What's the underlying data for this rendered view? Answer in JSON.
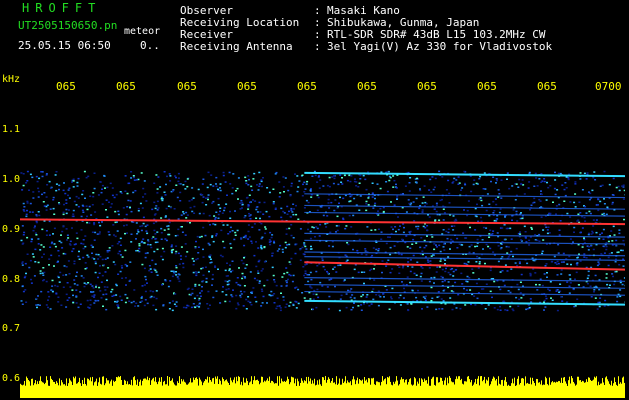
{
  "header": {
    "app_title": "HROFFT",
    "file_name": "UT2505150650.pn",
    "file_tag": "meteor",
    "date_time": "25.05.15 06:50",
    "count": "0.."
  },
  "metadata": [
    {
      "label": "Observer",
      "value": "Masaki Kano"
    },
    {
      "label": "Receiving Location",
      "value": "Shibukawa, Gunma, Japan"
    },
    {
      "label": "Receiver",
      "value": "RTL-SDR SDR# 43dB L15 103.2MHz CW"
    },
    {
      "label": "Receiving Antenna",
      "value": "3el Yagi(V) Az 330 for Vladivostok"
    }
  ],
  "colors": {
    "background": "#000000",
    "text_green": "#22dd22",
    "axis_yellow": "#ffff00",
    "echo_red": "#ff3333",
    "echo_cyan": "#33ddff",
    "noise_blue": "#1133cc"
  },
  "chart_data": {
    "type": "heatmap",
    "unit_label": "kHz",
    "y_tick_labels": [
      "1.1",
      "1.0",
      "0.9",
      "0.8",
      "0.7",
      "0.6"
    ],
    "x_tick_labels": [
      "065",
      "065",
      "065",
      "065",
      "065",
      "065",
      "065",
      "065",
      "065",
      "0700"
    ],
    "ylim": [
      0.6,
      1.15
    ],
    "strong_lines": [
      {
        "start_frac": 0.0,
        "end_frac": 1.0,
        "y_start": 0.945,
        "y_end": 0.935,
        "color": "red"
      },
      {
        "start_frac": 0.47,
        "end_frac": 1.0,
        "y_start": 0.853,
        "y_end": 0.837,
        "color": "red"
      },
      {
        "start_frac": 0.47,
        "end_frac": 1.0,
        "y_start": 1.045,
        "y_end": 1.038,
        "color": "cyan"
      },
      {
        "start_frac": 0.47,
        "end_frac": 1.0,
        "y_start": 0.77,
        "y_end": 0.762,
        "color": "cyan"
      }
    ]
  }
}
